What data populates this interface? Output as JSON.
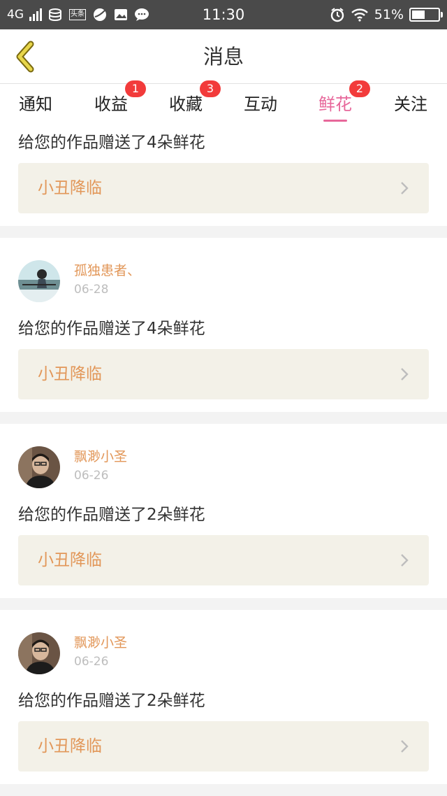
{
  "status_bar": {
    "network": "4G",
    "time": "11:30",
    "battery_percent": "51%",
    "battery_level": 0.51,
    "icons": [
      "signal-icon",
      "data-icon",
      "toutiao-icon",
      "app-icon",
      "gallery-icon",
      "chat-icon",
      "alarm-icon",
      "wifi-icon",
      "battery-icon"
    ],
    "toutiao_label": "头条"
  },
  "header": {
    "title": "消息",
    "back_icon": "chevron-left-icon"
  },
  "colors": {
    "accent": "#e7679a",
    "name": "#e29759",
    "badge": "#f23b3b",
    "back": "#e8d64a"
  },
  "tabs": [
    {
      "label": "通知",
      "badge": ""
    },
    {
      "label": "收益",
      "badge": "1"
    },
    {
      "label": "收藏",
      "badge": "3"
    },
    {
      "label": "互动",
      "badge": ""
    },
    {
      "label": "鲜花",
      "badge": "2",
      "active": true
    },
    {
      "label": "关注",
      "badge": ""
    }
  ],
  "feed": [
    {
      "message": "给您的作品赠送了4朵鲜花",
      "work_title": "小丑降临"
    },
    {
      "user": "孤独患者、",
      "date": "06-28",
      "message": "给您的作品赠送了4朵鲜花",
      "work_title": "小丑降临"
    },
    {
      "user": "飘渺小圣",
      "date": "06-26",
      "message": "给您的作品赠送了2朵鲜花",
      "work_title": "小丑降临"
    },
    {
      "user": "飘渺小圣",
      "date": "06-26",
      "message": "给您的作品赠送了2朵鲜花",
      "work_title": "小丑降临"
    }
  ]
}
